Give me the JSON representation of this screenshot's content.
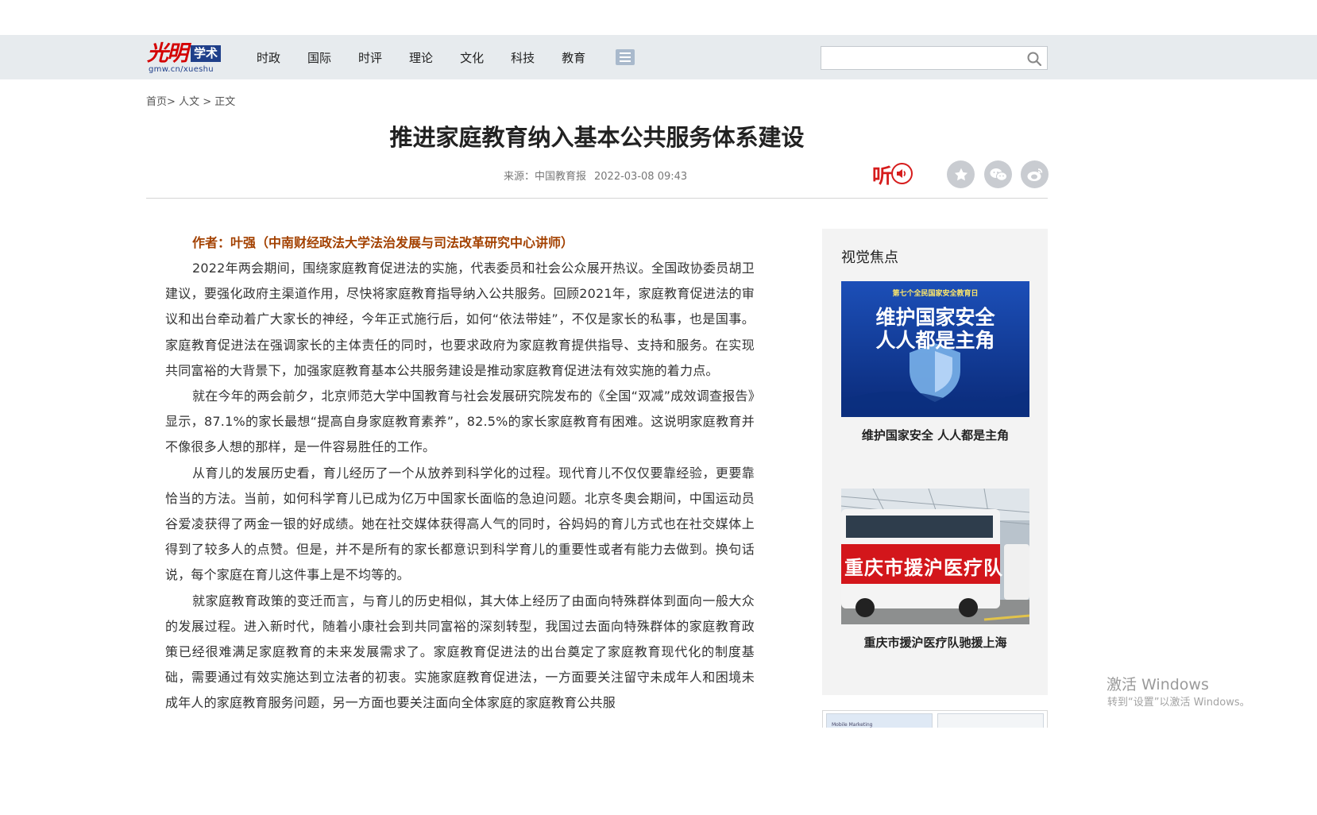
{
  "header": {
    "logo_script": "光明",
    "logo_box": "学术",
    "logo_url": "gmw.cn/xueshu",
    "nav": [
      "时政",
      "国际",
      "时评",
      "理论",
      "文化",
      "科技",
      "教育"
    ],
    "search_placeholder": ""
  },
  "breadcrumb": {
    "home": "首页",
    "sep1": ">",
    "section": "人文",
    "sep2": ">",
    "current": "正文"
  },
  "article": {
    "title": "推进家庭教育纳入基本公共服务体系建设",
    "source": "来源：中国教育报",
    "datetime": "2022-03-08 09:43",
    "listen_label": "听",
    "author": "作者：叶强（中南财经政法大学法治发展与司法改革研究中心讲师）",
    "paragraphs": [
      "2022年两会期间，围绕家庭教育促进法的实施，代表委员和社会公众展开热议。全国政协委员胡卫建议，要强化政府主渠道作用，尽快将家庭教育指导纳入公共服务。回顾2021年，家庭教育促进法的审议和出台牵动着广大家长的神经，今年正式施行后，如何“依法带娃”，不仅是家长的私事，也是国事。家庭教育促进法在强调家长的主体责任的同时，也要求政府为家庭教育提供指导、支持和服务。在实现共同富裕的大背景下，加强家庭教育基本公共服务建设是推动家庭教育促进法有效实施的着力点。",
      "就在今年的两会前夕，北京师范大学中国教育与社会发展研究院发布的《全国“双减”成效调查报告》显示，87.1%的家长最想“提高自身家庭教育素养”，82.5%的家长家庭教育有困难。这说明家庭教育并不像很多人想的那样，是一件容易胜任的工作。",
      "从育儿的发展历史看，育儿经历了一个从放养到科学化的过程。现代育儿不仅仅要靠经验，更要靠恰当的方法。当前，如何科学育儿已成为亿万中国家长面临的急迫问题。北京冬奥会期间，中国运动员谷爱凌获得了两金一银的好成绩。她在社交媒体获得高人气的同时，谷妈妈的育儿方式也在社交媒体上得到了较多人的点赞。但是，并不是所有的家长都意识到科学育儿的重要性或者有能力去做到。换句话说，每个家庭在育儿这件事上是不均等的。",
      "就家庭教育政策的变迁而言，与育儿的历史相似，其大体上经历了由面向特殊群体到面向一般大众的发展过程。进入新时代，随着小康社会到共同富裕的深刻转型，我国过去面向特殊群体的家庭教育政策已经很难满足家庭教育的未来发展需求了。家庭教育促进法的出台奠定了家庭教育现代化的制度基础，需要通过有效实施达到立法者的初衷。实施家庭教育促进法，一方面要关注留守未成年人和困境未成年人的家庭教育服务问题，另一方面也要关注面向全体家庭的家庭教育公共服"
    ]
  },
  "sidebar": {
    "title": "视觉焦点",
    "items": [
      {
        "banner_top": "第七个全民国家安全教育日",
        "banner_line1": "维护国家安全",
        "banner_line2": "人人都是主角",
        "caption": "维护国家安全 人人都是主角"
      },
      {
        "bus_text": "重庆市援沪医疗队",
        "caption": "重庆市援沪医疗队驰援上海"
      }
    ],
    "ad_text": "Mobile Marketing"
  },
  "watermark": {
    "line1": "激活 Windows",
    "line2": "转到“设置”以激活 Windows。"
  },
  "colors": {
    "nav_bg": "#e7ebee",
    "brand_red": "#d40000",
    "brand_blue": "#1f3f8a",
    "author_color": "#a34100",
    "listen_red": "#d61c1c"
  }
}
